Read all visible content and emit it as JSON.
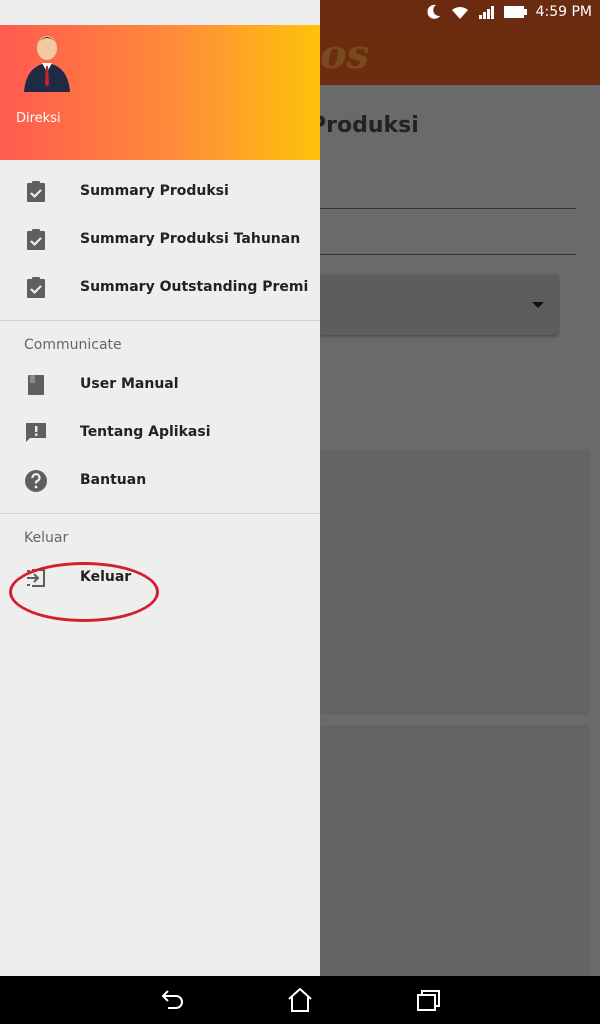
{
  "status_bar": {
    "time": "4:59 PM",
    "left_icons": [
      "gmail-icon",
      "photos-icon",
      "clipboard-check-icon"
    ],
    "right_icons": [
      "moon-icon",
      "wifi-icon",
      "signal-icon",
      "battery-icon"
    ]
  },
  "background_app": {
    "title_fragment": "Produksi",
    "logo_fragment": "os"
  },
  "drawer": {
    "header": {
      "user_role": "Direksi",
      "avatar_icon": "businessman-avatar"
    },
    "items": [
      {
        "label": "Summary Produksi",
        "icon": "clipboard-check-icon"
      },
      {
        "label": "Summary Produksi Tahunan",
        "icon": "clipboard-check-icon"
      },
      {
        "label": "Summary Outstanding Premi",
        "icon": "clipboard-check-icon"
      }
    ],
    "communicate": {
      "section_label": "Communicate",
      "items": [
        {
          "label": "User Manual",
          "icon": "book-icon"
        },
        {
          "label": "Tentang Aplikasi",
          "icon": "feedback-icon"
        },
        {
          "label": "Bantuan",
          "icon": "help-icon"
        }
      ]
    },
    "keluar": {
      "section_label": "Keluar",
      "items": [
        {
          "label": "Keluar",
          "icon": "logout-icon"
        }
      ]
    }
  },
  "navigation_bar": {
    "buttons": [
      "back",
      "home",
      "recents"
    ]
  },
  "colors": {
    "header_gradient_start": "#ff5a50",
    "header_gradient_end": "#ffc20a",
    "highlight_ring": "#d61e2c",
    "drawer_bg": "#eeeeee"
  }
}
